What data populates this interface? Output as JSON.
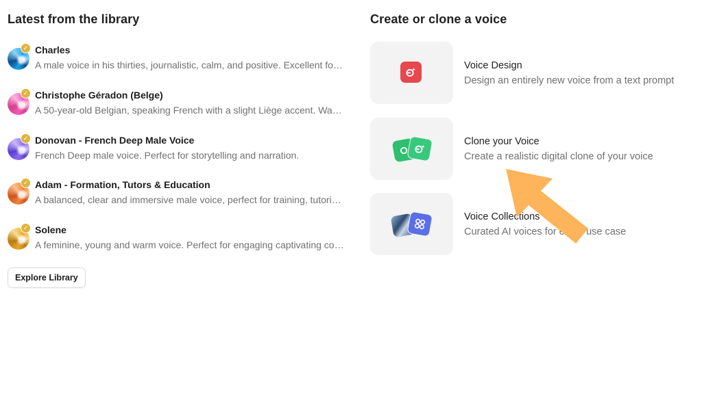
{
  "library": {
    "title": "Latest from the library",
    "voices": [
      {
        "name": "Charles",
        "description": "A male voice in his thirties, journalistic, calm, and positive. Excellent for narration and storytelling.",
        "avatar_colors": [
          "#1aa3e8",
          "#0c4f8f",
          "#8fd3f5"
        ]
      },
      {
        "name": "Christophe Géradon (Belge)",
        "description": "A 50-year-old Belgian, speaking French with a slight Liège accent. Warm and friendly.",
        "avatar_colors": [
          "#f05bb8",
          "#d43f8c",
          "#f9b5e0"
        ]
      },
      {
        "name": "Donovan - French Deep Male Voice",
        "description": "French Deep male voice. Perfect for storytelling and narration.",
        "avatar_colors": [
          "#8c6cf0",
          "#5a3fd0",
          "#c9b8fb"
        ]
      },
      {
        "name": "Adam - Formation, Tutors & Education",
        "description": "A balanced, clear and immersive male voice, perfect for training, tutorials and education.",
        "avatar_colors": [
          "#f2843a",
          "#d0541b",
          "#fbc08f"
        ]
      },
      {
        "name": "Solene",
        "description": "A feminine, young and warm voice. Perfect for engaging captivating content.",
        "avatar_colors": [
          "#e9a92a",
          "#b97a10",
          "#f7dc91"
        ]
      }
    ],
    "verified_icon": "verified-badge-icon",
    "explore_label": "Explore Library"
  },
  "create": {
    "title": "Create or clone a voice",
    "cards": [
      {
        "title": "Voice Design",
        "description": "Design an entirely new voice from a text prompt",
        "icon": "voice-design-icon",
        "accent": "#e5484d"
      },
      {
        "title": "Clone your Voice",
        "description": "Create a realistic digital clone of your voice",
        "icon": "voice-clone-icon",
        "accent": "#2fbf71"
      },
      {
        "title": "Voice Collections",
        "description": "Curated AI voices for every use case",
        "icon": "voice-collections-icon",
        "accent": "#5b6ee8"
      }
    ]
  },
  "annotation": {
    "arrow_color": "#fdb45a",
    "arrow_icon": "pointer-arrow-icon"
  }
}
